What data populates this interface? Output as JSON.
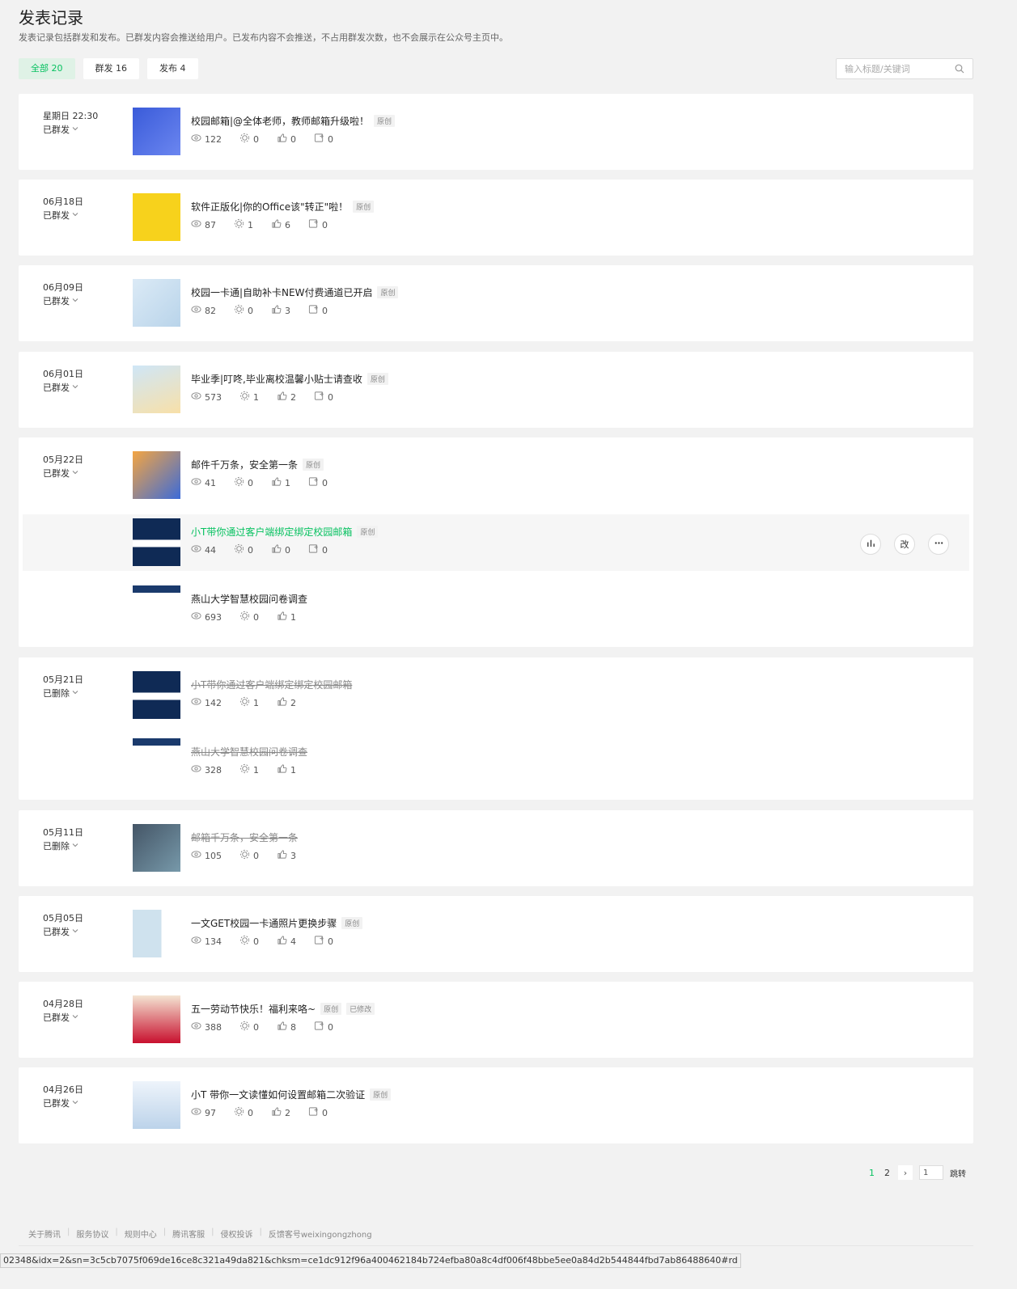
{
  "page": {
    "title": "发表记录",
    "desc": "发表记录包括群发和发布。已群发内容会推送给用户。已发布内容不会推送，不占用群发次数，也不会展示在公众号主页中。"
  },
  "tabs": [
    {
      "label": "全部 20",
      "active": true
    },
    {
      "label": "群发 16"
    },
    {
      "label": "发布 4"
    }
  ],
  "search": {
    "placeholder": "输入标题/关键词"
  },
  "records": [
    {
      "date": "星期日 22:30",
      "status": "已群发",
      "articles": [
        {
          "title": "校园邮箱|@全体老师，教师邮箱升级啦！",
          "tags": [
            "原创"
          ],
          "read": "122",
          "share": "0",
          "like": "0",
          "comment": "0"
        }
      ]
    },
    {
      "date": "06月18日",
      "status": "已群发",
      "articles": [
        {
          "title": "软件正版化|你的Office该\"转正\"啦！",
          "tags": [
            "原创"
          ],
          "read": "87",
          "share": "1",
          "like": "6",
          "comment": "0"
        }
      ]
    },
    {
      "date": "06月09日",
      "status": "已群发",
      "articles": [
        {
          "title": "校园一卡通|自助补卡NEW付费通道已开启",
          "tags": [
            "原创"
          ],
          "read": "82",
          "share": "0",
          "like": "3",
          "comment": "0"
        }
      ]
    },
    {
      "date": "06月01日",
      "status": "已群发",
      "articles": [
        {
          "title": "毕业季|叮咚,毕业离校温馨小贴士请查收",
          "tags": [
            "原创"
          ],
          "read": "573",
          "share": "1",
          "like": "2",
          "comment": "0"
        }
      ]
    },
    {
      "date": "05月22日",
      "status": "已群发",
      "articles": [
        {
          "title": "邮件千万条，安全第一条",
          "tags": [
            "原创"
          ],
          "read": "41",
          "share": "0",
          "like": "1",
          "comment": "0"
        },
        {
          "title": "小T带你通过客户端绑定绑定校园邮箱",
          "tags": [
            "原创"
          ],
          "read": "44",
          "share": "0",
          "like": "0",
          "comment": "0",
          "actions": [
            "改"
          ]
        },
        {
          "title": "燕山大学智慧校园问卷调查",
          "tags": [],
          "read": "693",
          "share": "0",
          "like": "1"
        }
      ]
    },
    {
      "date": "05月21日",
      "status": "已删除",
      "articles": [
        {
          "title": "小T带你通过客户端绑定绑定校园邮箱",
          "tags": [],
          "read": "142",
          "share": "1",
          "like": "2"
        },
        {
          "title": "燕山大学智慧校园问卷调查",
          "tags": [],
          "read": "328",
          "share": "1",
          "like": "1"
        }
      ]
    },
    {
      "date": "05月11日",
      "status": "已删除",
      "articles": [
        {
          "title": "邮箱千万条，安全第一条",
          "tags": [],
          "read": "105",
          "share": "0",
          "like": "3"
        }
      ]
    },
    {
      "date": "05月05日",
      "status": "已群发",
      "articles": [
        {
          "title": "一文GET校园一卡通照片更换步骤",
          "tags": [
            "原创"
          ],
          "read": "134",
          "share": "0",
          "like": "4",
          "comment": "0"
        }
      ]
    },
    {
      "date": "04月28日",
      "status": "已群发",
      "articles": [
        {
          "title": "五一劳动节快乐！福利来咯~",
          "tags": [
            "原创",
            "已修改"
          ],
          "read": "388",
          "share": "0",
          "like": "8",
          "comment": "0"
        }
      ]
    },
    {
      "date": "04月26日",
      "status": "已群发",
      "articles": [
        {
          "title": "小T 带你一文读懂如何设置邮箱二次验证",
          "tags": [
            "原创"
          ],
          "read": "97",
          "share": "0",
          "like": "2",
          "comment": "0"
        }
      ]
    }
  ],
  "pagination": {
    "pages": [
      "1",
      "2"
    ],
    "next": "›",
    "input_value": "1",
    "jump": "跳转"
  },
  "footer": [
    "关于腾讯",
    "服务协议",
    "规则中心",
    "腾讯客服",
    "侵权投诉",
    "反馈客号weixingongzhong"
  ],
  "url": "02348&idx=2&sn=3c5cb7075f069de16ce8c321a49da821&chksm=ce1dc912f96a400462184b724efba80a8c4df006f48bbe5ee0a84d2b544844fbd7ab86488640#rd",
  "colors": {
    "accent": "#07c160",
    "background": "#f2f2f2"
  }
}
